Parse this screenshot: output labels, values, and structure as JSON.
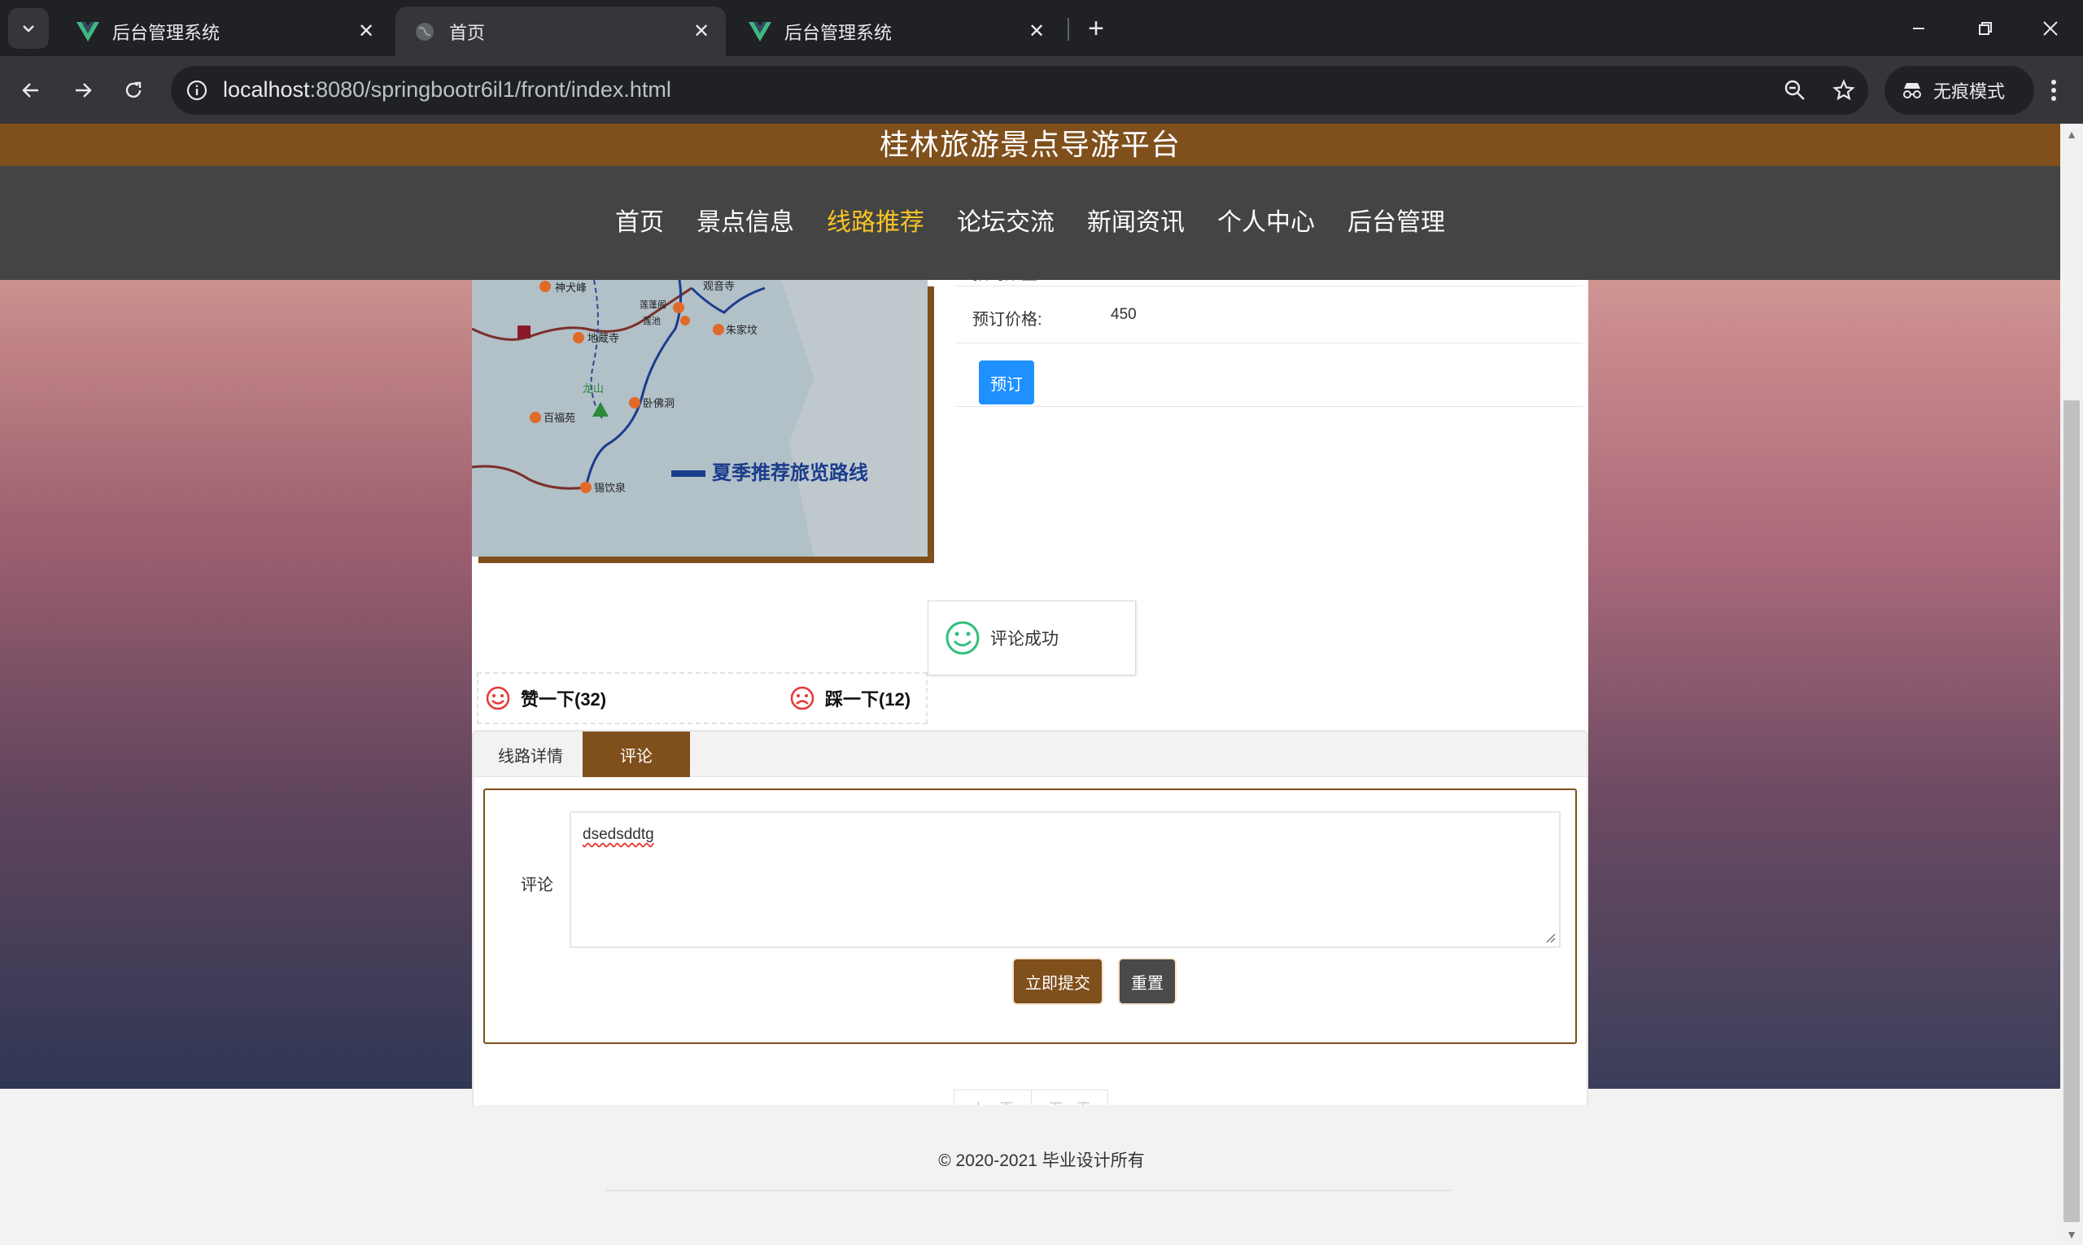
{
  "browser": {
    "tabs": [
      {
        "title": "后台管理系统",
        "active": false
      },
      {
        "title": "首页",
        "active": true
      },
      {
        "title": "后台管理系统",
        "active": false
      }
    ],
    "url_host": "localhost",
    "url_rest": ":8080/springbootr6il1/front/index.html",
    "incognito_label": "无痕模式"
  },
  "site": {
    "title": "桂林旅游景点导游平台",
    "nav": [
      "首页",
      "景点信息",
      "线路推荐",
      "论坛交流",
      "新闻资讯",
      "个人中心",
      "后台管理"
    ],
    "active_nav": "线路推荐"
  },
  "detail": {
    "map_caption": "夏季推荐旅览路线",
    "map_labels": [
      "神犬峰",
      "观音寺",
      "莲蓬阁",
      "莲池",
      "朱家坟",
      "地蔵寺",
      "龙山",
      "卧佛洞",
      "百福苑",
      "锡饮泉"
    ],
    "partial_row_label": "预约数量:",
    "price_label": "预订价格:",
    "price_value": "450",
    "book_button": "预订",
    "toast": "评论成功",
    "like_label": "赞一下(32)",
    "dislike_label": "踩一下(12)"
  },
  "tabs": {
    "items": [
      "线路详情",
      "评论"
    ],
    "selected": "评论"
  },
  "comment_form": {
    "label": "评论",
    "value": "dsedsddtg",
    "submit": "立即提交",
    "reset": "重置"
  },
  "pager": {
    "prev": "上一页",
    "next": "下一页"
  },
  "footer": {
    "copyright": "© 2020-2021 毕业设计所有"
  },
  "colors": {
    "brand": "#7f4f1c",
    "nav_active": "#f7c325",
    "primary_button": "#1e90ff"
  }
}
